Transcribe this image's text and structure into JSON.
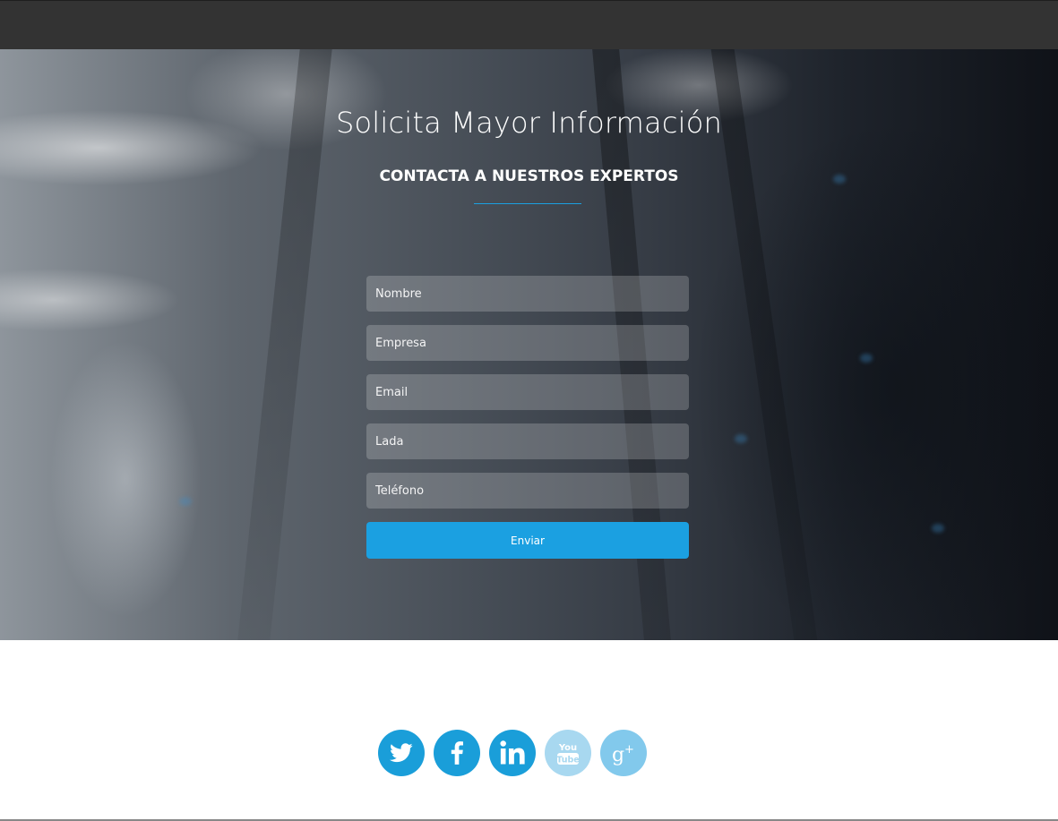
{
  "hero": {
    "title": "Solicita Mayor Información",
    "subtitle": "CONTACTA A NUESTROS EXPERTOS",
    "accent_color": "#1ba0e1"
  },
  "form": {
    "fields": [
      {
        "placeholder": "Nombre"
      },
      {
        "placeholder": "Empresa"
      },
      {
        "placeholder": "Email"
      },
      {
        "placeholder": "Lada"
      },
      {
        "placeholder": "Teléfono"
      }
    ],
    "submit_label": "Enviar"
  },
  "social": {
    "icons": [
      "twitter-icon",
      "facebook-icon",
      "linkedin-icon",
      "youtube-icon",
      "google-plus-icon"
    ],
    "primary_color": "#1a9ed9",
    "youtube_color": "#a8d8f0",
    "google_plus_color": "#82c9ec"
  }
}
